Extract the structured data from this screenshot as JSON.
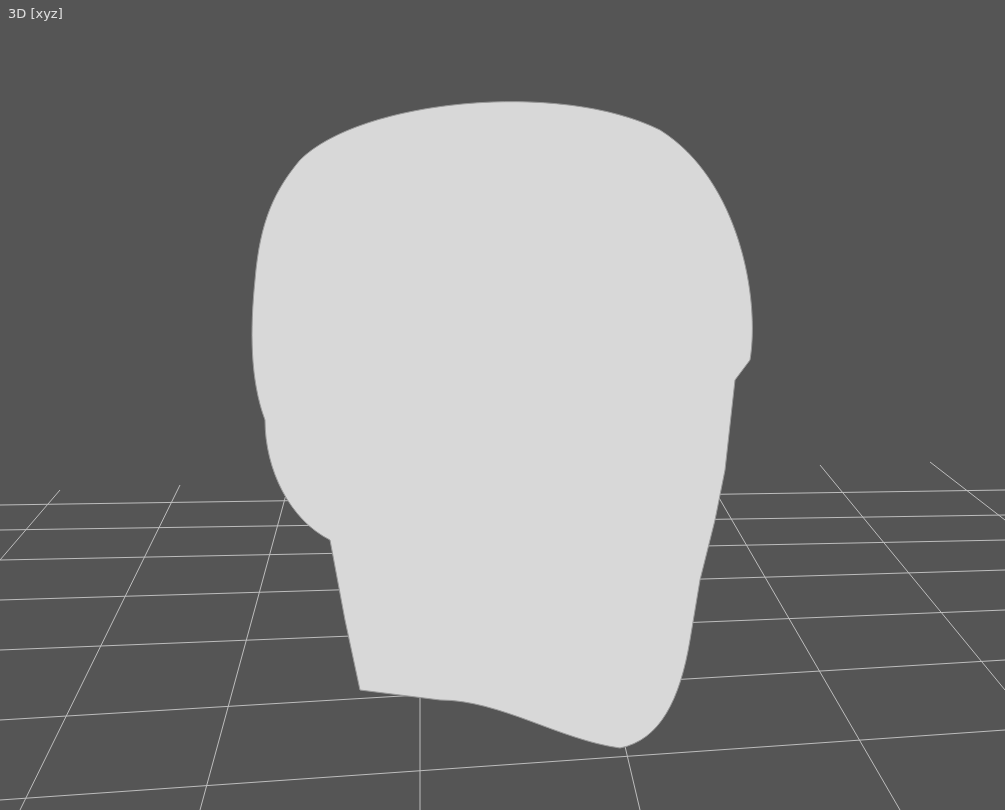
{
  "viewport": {
    "label": "3D [xyz]"
  }
}
